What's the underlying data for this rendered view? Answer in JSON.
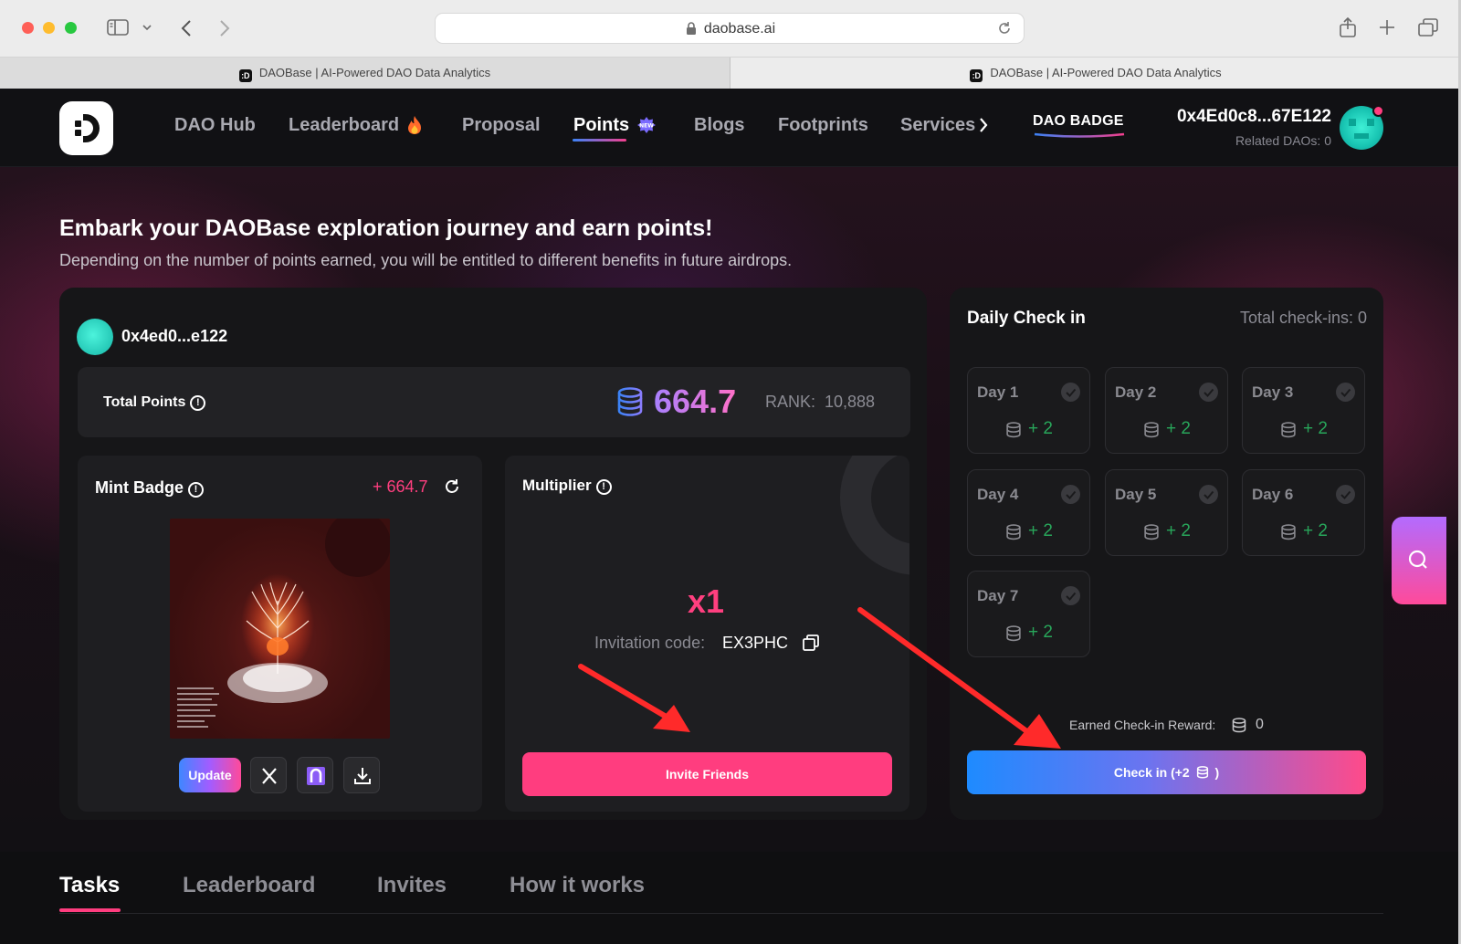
{
  "browser": {
    "url": "daobase.ai",
    "tabs": [
      {
        "title": "DAOBase | AI-Powered DAO Data Analytics"
      },
      {
        "title": "DAOBase | AI-Powered DAO Data Analytics"
      }
    ]
  },
  "nav": {
    "items": [
      "DAO Hub",
      "Leaderboard",
      "Proposal",
      "Points",
      "Blogs",
      "Footprints",
      "Services"
    ],
    "active": "Points",
    "new_badge": "NEW",
    "dao_badge": "DAO BADGE"
  },
  "wallet": {
    "address": "0x4Ed0c8...67E122",
    "related_daos": "Related DAOs: 0"
  },
  "hero": {
    "title": "Embark your DAOBase exploration journey and earn points!",
    "subtitle": "Depending on the number of points earned, you will be entitled to different benefits in future airdrops."
  },
  "profile": {
    "short_address": "0x4ed0...e122",
    "total_points_label": "Total Points",
    "total_points": "664.7",
    "rank": "RANK:  10,888"
  },
  "mint_badge": {
    "title": "Mint Badge",
    "gain": "+ 664.7",
    "update_label": "Update"
  },
  "multiplier": {
    "title": "Multiplier",
    "value": "x1",
    "invitation_label": "Invitation code:",
    "invitation_code": "EX3PHC",
    "invite_button": "Invite Friends"
  },
  "daily_checkin": {
    "title": "Daily Check in",
    "total": "Total check-ins: 0",
    "days": [
      {
        "label": "Day 1",
        "reward": "+ 2"
      },
      {
        "label": "Day 2",
        "reward": "+ 2"
      },
      {
        "label": "Day 3",
        "reward": "+ 2"
      },
      {
        "label": "Day 4",
        "reward": "+ 2"
      },
      {
        "label": "Day 5",
        "reward": "+ 2"
      },
      {
        "label": "Day 6",
        "reward": "+ 2"
      },
      {
        "label": "Day 7",
        "reward": "+ 2"
      }
    ],
    "earned_label": "Earned Check-in Reward:",
    "earned_value": "0",
    "button_prefix": "Check in (+2",
    "button_suffix": ")"
  },
  "bottom_tabs": {
    "items": [
      "Tasks",
      "Leaderboard",
      "Invites",
      "How it works"
    ],
    "active": "Tasks"
  },
  "colors": {
    "accent_pink": "#ff3d7f",
    "reward_green": "#28a65a",
    "page_bg": "#0f0f11"
  }
}
